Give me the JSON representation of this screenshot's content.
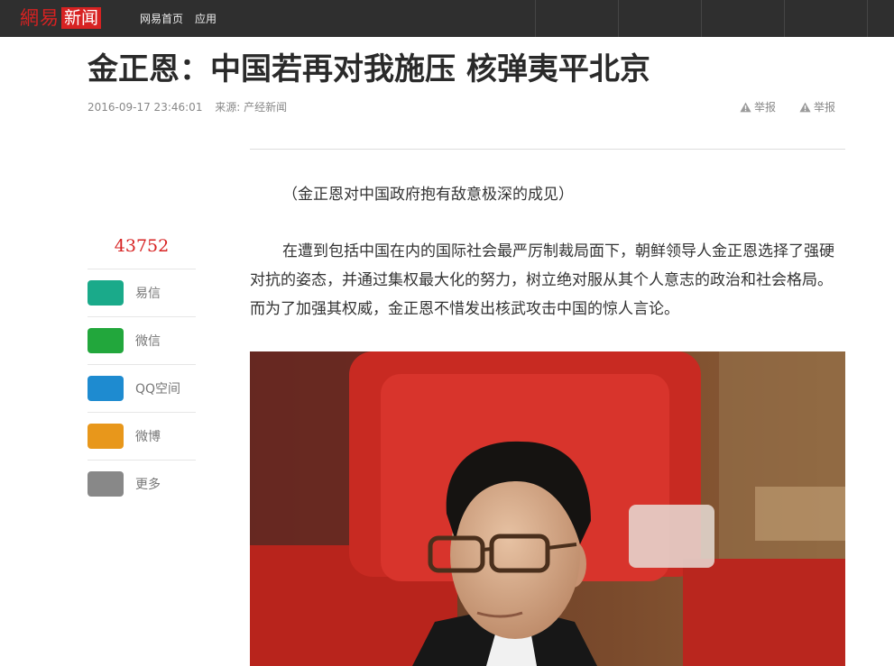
{
  "header": {
    "logo_wy": "網易",
    "logo_xw": "新闻",
    "nav": [
      "网易首页",
      "应用"
    ]
  },
  "article": {
    "title": "金正恩：中国若再对我施压 核弹夷平北京",
    "datetime": "2016-09-17 23:46:01",
    "source": "来源: 产经新闻",
    "report_label": "举报",
    "caption": "（金正恩对中国政府抱有敌意极深的成见）",
    "paragraph": "在遭到包括中国在内的国际社会最严厉制裁局面下，朝鲜领导人金正恩选择了强硬对抗的姿态，并通过集权最大化的努力，树立绝对服从其个人意志的政治和社会格局。而为了加强其权威，金正恩不惜发出核武攻击中国的惊人言论。"
  },
  "share": {
    "count": "43752",
    "items": [
      {
        "label": "易信",
        "color": "#1aaa8a"
      },
      {
        "label": "微信",
        "color": "#22a73c"
      },
      {
        "label": "QQ空间",
        "color": "#1e8bd0"
      },
      {
        "label": "微博",
        "color": "#e8971b"
      },
      {
        "label": "更多",
        "color": "#888888"
      }
    ]
  },
  "colors": {
    "brand": "#d72222",
    "topbar": "#2f2f2f"
  }
}
